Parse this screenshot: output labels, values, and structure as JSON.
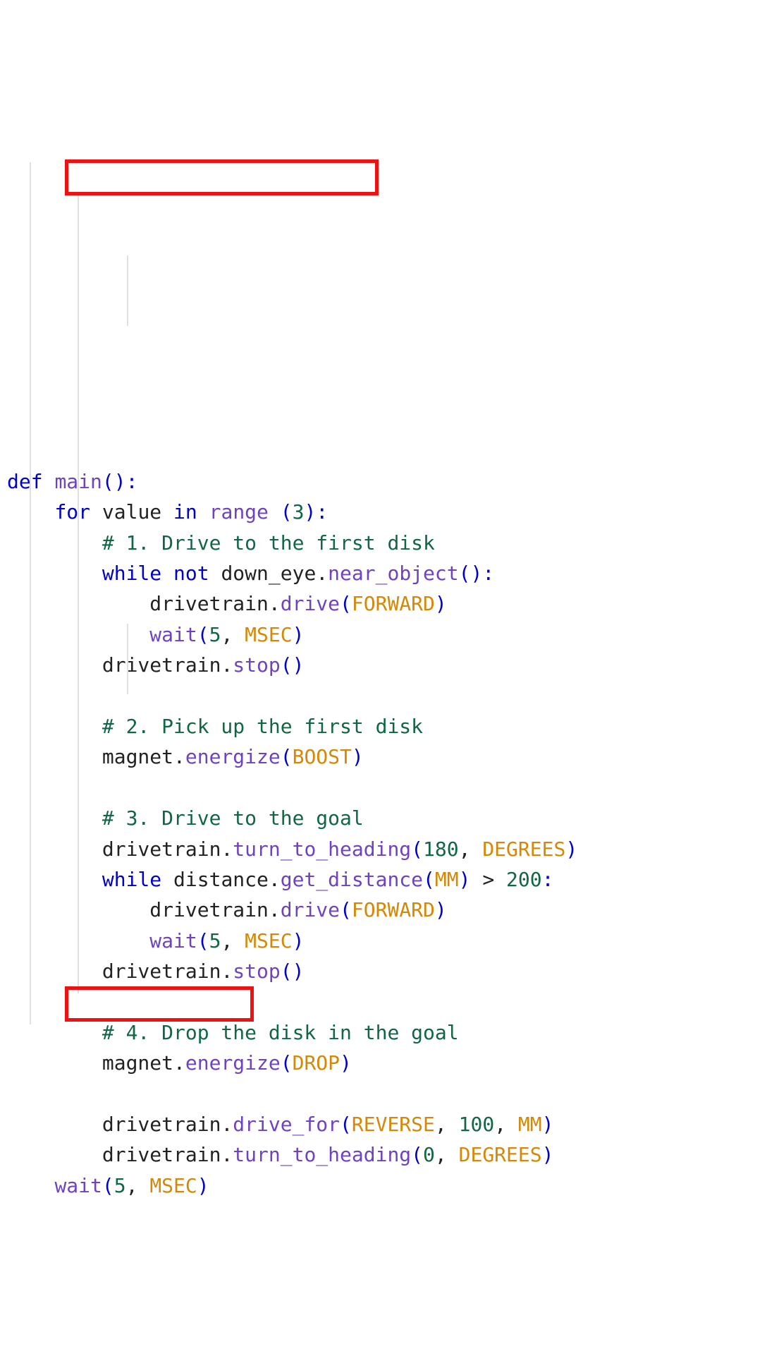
{
  "tokens": {
    "def": "def",
    "main": "main",
    "colon": ":",
    "for": "for",
    "value": "value",
    "in": "in",
    "range": "range",
    "n3": "3",
    "c1": "# 1. Drive to the first disk",
    "while": "while",
    "not": "not",
    "down_eye": "down_eye",
    "near_object": "near_object",
    "drivetrain": "drivetrain",
    "drive": "drive",
    "FORWARD": "FORWARD",
    "wait": "wait",
    "n5": "5",
    "MSEC": "MSEC",
    "stop": "stop",
    "c2": "# 2. Pick up the first disk",
    "magnet": "magnet",
    "energize": "energize",
    "BOOST": "BOOST",
    "c3": "# 3. Drive to the goal",
    "turn_to_heading": "turn_to_heading",
    "n180": "180",
    "DEGREES": "DEGREES",
    "distance": "distance",
    "get_distance": "get_distance",
    "MM": "MM",
    "gt": ">",
    "n200": "200",
    "c4": "# 4. Drop the disk in the goal",
    "DROP": "DROP",
    "drive_for": "drive_for",
    "REVERSE": "REVERSE",
    "n100": "100",
    "n0": "0",
    "lp": "(",
    "rp": ")",
    "dot": ".",
    "comma": ","
  },
  "highlights": {
    "for_loop_line": "for value in range (3):",
    "last_wait_line": "wait(5, MSEC)"
  }
}
